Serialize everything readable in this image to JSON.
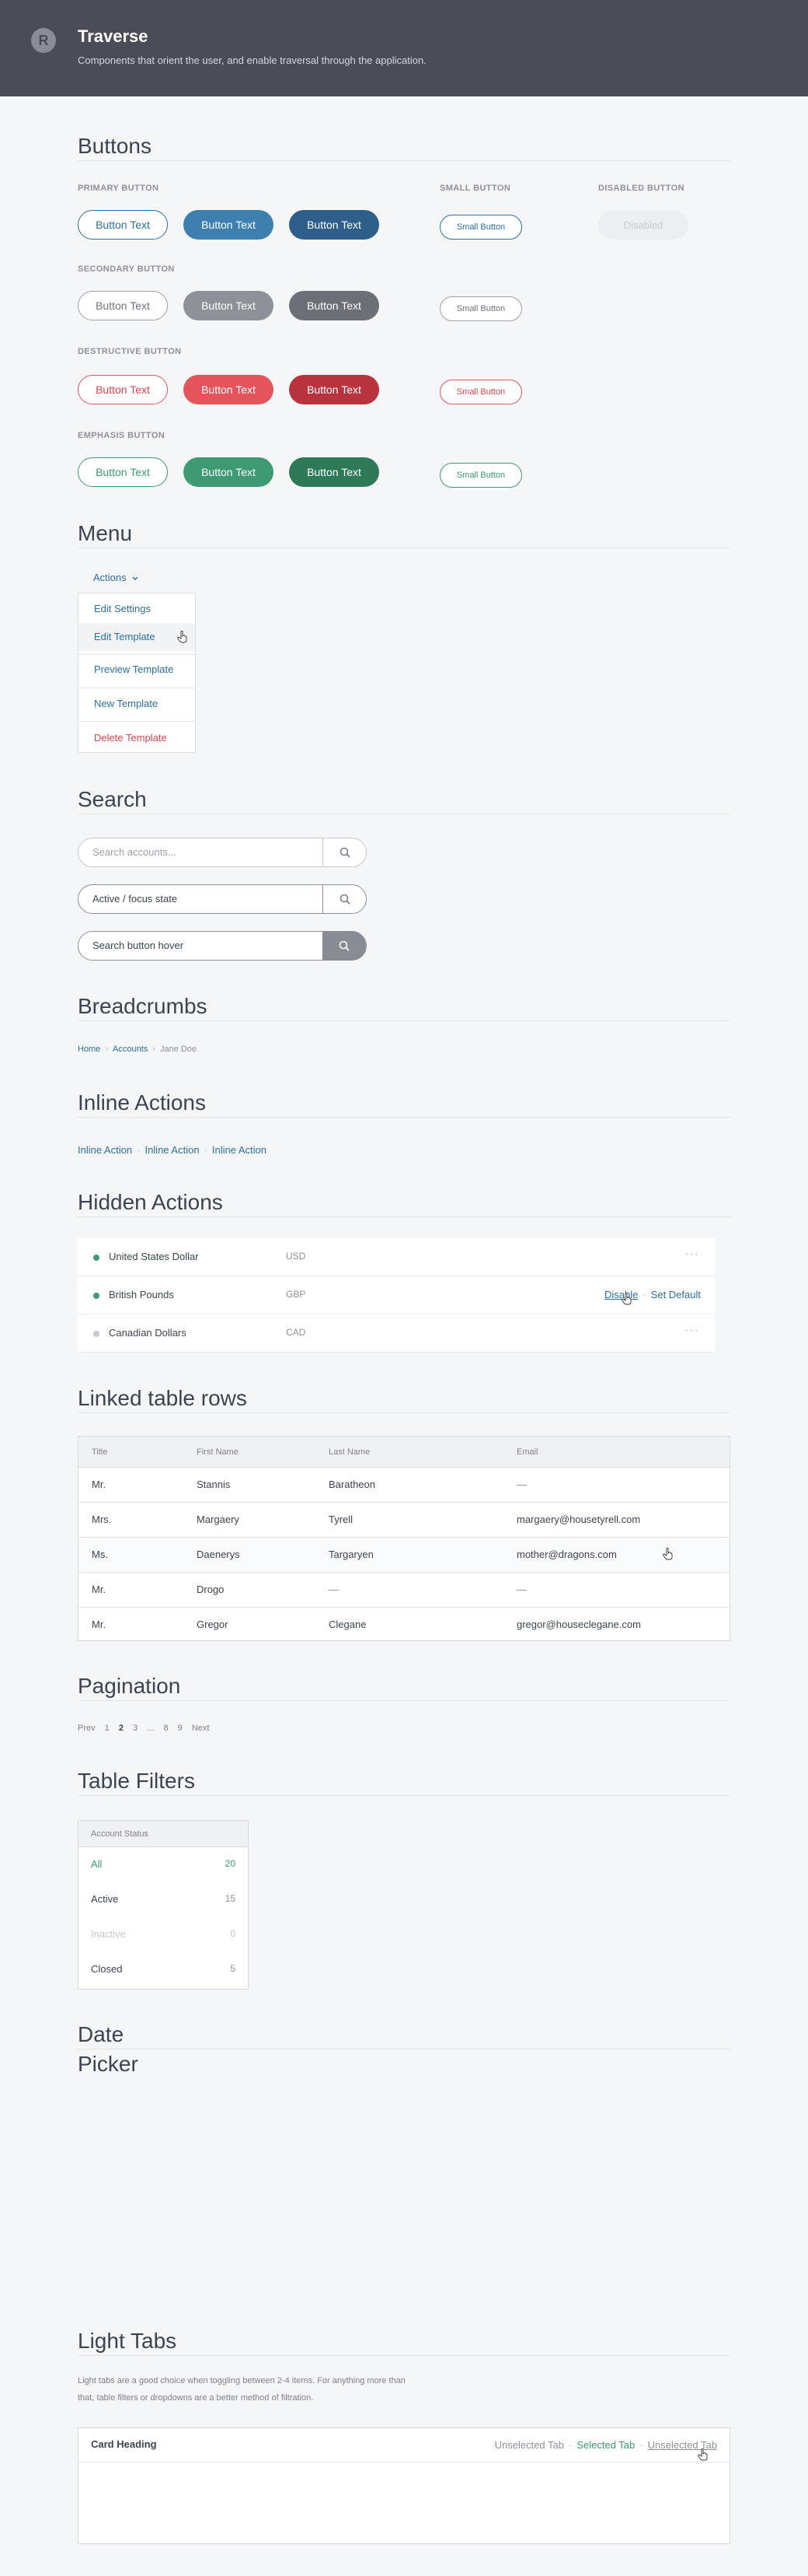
{
  "header": {
    "logo_letter": "R",
    "title": "Traverse",
    "subtitle": "Components that orient the user, and enable traversal through the application."
  },
  "buttons": {
    "title": "Buttons",
    "primary_label": "PRIMARY BUTTON",
    "secondary_label": "SECONDARY BUTTON",
    "destructive_label": "DESTRUCTIVE BUTTON",
    "emphasis_label": "EMPHASIS BUTTON",
    "small_label": "SMALL BUTTON",
    "disabled_label": "DISABLED BUTTON",
    "button_text": "Button Text",
    "small_text": "Small Button",
    "disabled_text": "Disabled"
  },
  "menu": {
    "title": "Menu",
    "trigger": "Actions",
    "items": [
      "Edit Settings",
      "Edit Template",
      "Preview Template",
      "New Template",
      "Delete Template"
    ]
  },
  "search": {
    "title": "Search",
    "placeholder": "Search accounts...",
    "active_value": "Active / focus state",
    "hover_value": "Search button hover"
  },
  "breadcrumbs": {
    "title": "Breadcrumbs",
    "items": [
      "Home",
      "Accounts",
      "Jane Doe"
    ]
  },
  "inline_actions": {
    "title": "Inline Actions",
    "items": [
      "Inline Action",
      "Inline Action",
      "Inline Action"
    ]
  },
  "hidden_actions": {
    "title": "Hidden Actions",
    "more": "···",
    "disable": "Disable",
    "set_default": "Set Default",
    "rows": [
      {
        "name": "United States Dollar",
        "code": "USD",
        "status": "#3e9a72"
      },
      {
        "name": "British Pounds",
        "code": "GBP",
        "status": "#3e9a72"
      },
      {
        "name": "Canadian Dollars",
        "code": "CAD",
        "status": "#c6c9cf"
      }
    ]
  },
  "linked_table": {
    "title": "Linked table rows",
    "columns": [
      "Title",
      "First Name",
      "Last Name",
      "Email"
    ],
    "rows": [
      [
        "Mr.",
        "Stannis",
        "Baratheon",
        "—"
      ],
      [
        "Mrs.",
        "Margaery",
        "Tyrell",
        "margaery@housetyrell.com"
      ],
      [
        "Ms.",
        "Daenerys",
        "Targaryen",
        "mother@dragons.com"
      ],
      [
        "Mr.",
        "Drogo",
        "—",
        "—"
      ],
      [
        "Mr.",
        "Gregor",
        "Clegane",
        "gregor@houseclegane.com"
      ]
    ]
  },
  "pagination": {
    "title": "Pagination",
    "prev": "Prev",
    "pages": [
      "1",
      "2",
      "3",
      "...",
      "8",
      "9"
    ],
    "current": "2",
    "next": "Next"
  },
  "table_filters": {
    "title": "Table Filters",
    "header": "Account Status",
    "rows": [
      {
        "label": "All",
        "count": "20"
      },
      {
        "label": "Active",
        "count": "15"
      },
      {
        "label": "Inactive",
        "count": "0"
      },
      {
        "label": "Closed",
        "count": "5"
      }
    ]
  },
  "date_picker": {
    "title_line1": "Date",
    "title_line2": "Picker"
  },
  "light_tabs": {
    "title": "Light Tabs",
    "description": "Light tabs are a good choice when toggling between 2-4 items. For anything more than that,  table filters or dropdowns are a better method of filtration.",
    "card_heading": "Card Heading",
    "tabs": [
      "Unselected Tab",
      "Selected Tab",
      "Unselected Tab"
    ]
  },
  "colors": {
    "header_bg": "#4a4c58",
    "link": "#2f6f9f",
    "success": "#3e9a72",
    "danger": "#d9454f"
  }
}
